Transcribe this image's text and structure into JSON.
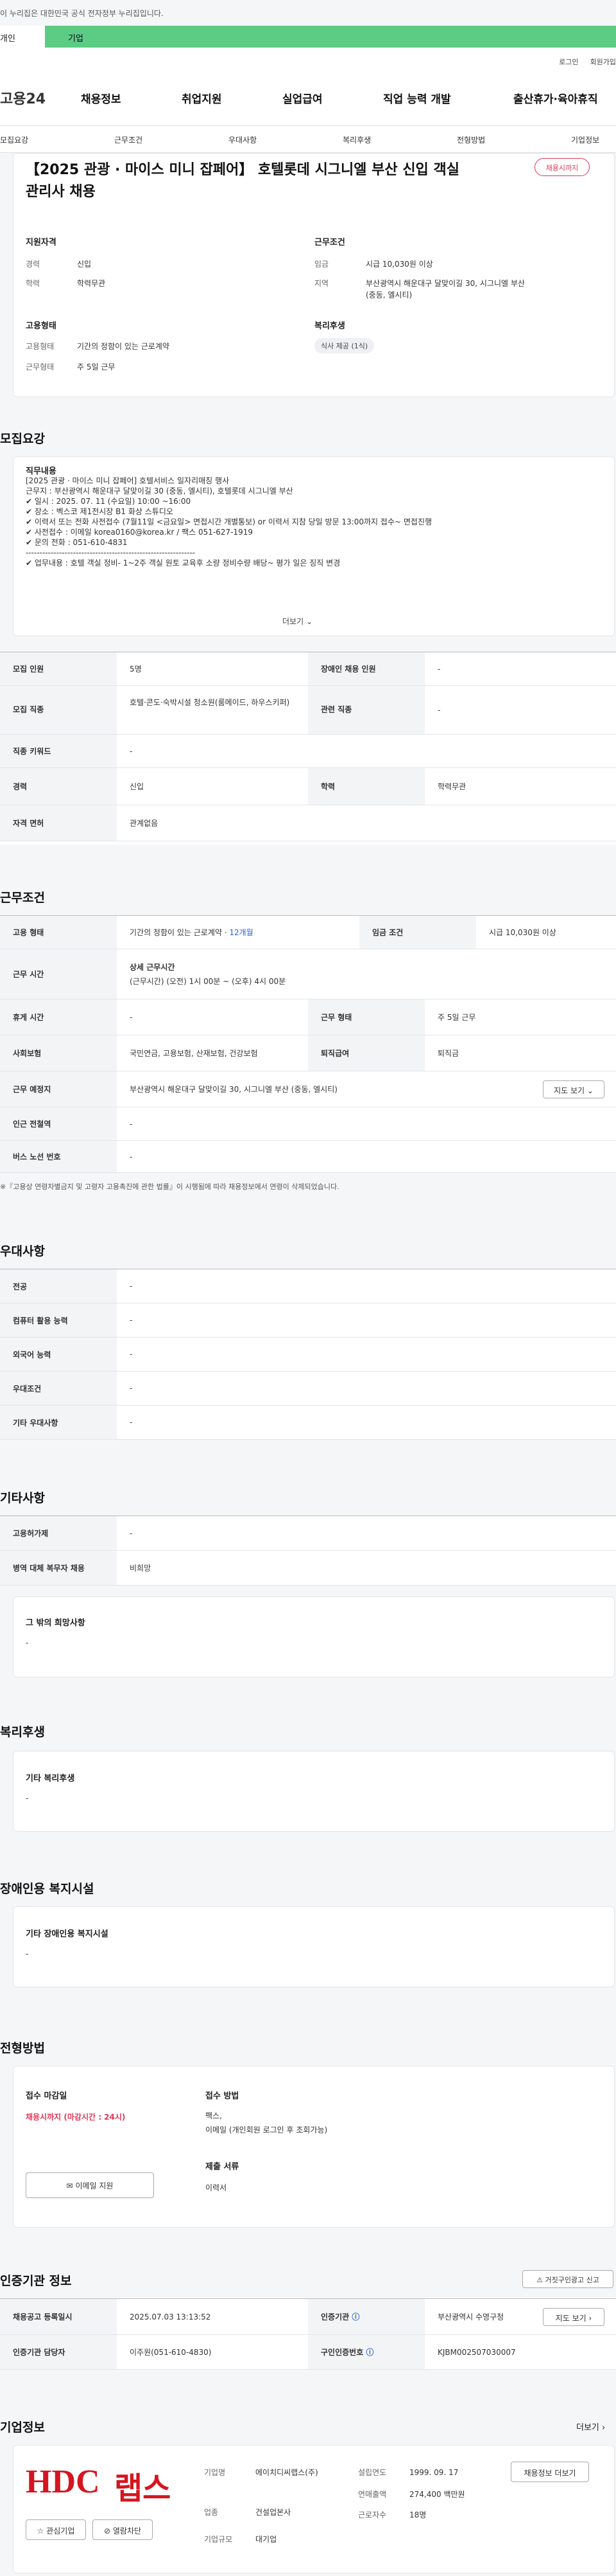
{
  "gov_banner": "이 누리집은 대한민국 공식 전자정부 누리집입니다.",
  "top_tabs": [
    "개인",
    "기업"
  ],
  "utils": [
    "로그인",
    "회원가입"
  ],
  "logo": "고용24",
  "gnb": [
    "채용정보",
    "취업지원",
    "실업급여",
    "직업 능력 개발",
    "출산휴가·육아휴직"
  ],
  "subnav": [
    "모집요강",
    "근무조건",
    "우대사항",
    "복리후생",
    "전형방법",
    "기업정보"
  ],
  "job": {
    "title": "【2025 관광 · 마이스 미니 잡페어】 호텔롯데 시그니엘 부산 신입 객실관리사 채용",
    "badge": "채용시까지",
    "qual_h": "지원자격",
    "career_k": "경력",
    "career_v": "신입",
    "edu_k": "학력",
    "edu_v": "학력무관",
    "cond_h": "근무조건",
    "wage_k": "임금",
    "wage_v": "시급 10,030원 이상",
    "area_k": "지역",
    "area_v": "부산광역시 해운대구 달맞이길 30, 시그니엘 부산 (중동, 엘시티)",
    "emp_h": "고용형태",
    "emptype_k": "고용형태",
    "emptype_v": "기간의 정함이 있는 근로계약",
    "worktype_k": "근무형태",
    "worktype_v": "주 5일 근무",
    "welfare_h": "복리후생",
    "welfare_pill": "식사 제공 (1식)"
  },
  "recruit": {
    "h": "모집요강",
    "duty_h": "직무내용",
    "desc": "[2025 관광 · 마이스 미니 잡페어] 호텔서비스 일자리매칭 행사\n근무지 : 부산광역시 해운대구 달맞이길 30 (중동, 엘시티), 호텔롯데 시그니엘 부산\n✔ 일시 : 2025. 07. 11 (수요일) 10:00 ~16:00\n✔ 장소 : 벡스코 제1전시장 B1 화상 스튜디오\n✔ 이력서 또는 전화 사전접수 (7월11일 <금요일> 면접시간 개별통보) or 이력서 지참 당일 방문 13:00까지 접수~ 면접진행\n✔ 사전접수 : 이메일 korea0160@korea.kr / 팩스 051-627-1919\n✔ 문의 전화 : 051-610-4831\n-------------------------------------------------------------\n✔ 업무내용 : 호텔 객실 정비- 1~2주 객실 원토 교육후 소량 정비수량 배당~ 평가 일은 징직 변경",
    "more": "더보기",
    "rows": [
      {
        "k": "모집 인원",
        "v": "5명",
        "k2": "장애인 채용 인원",
        "v2": "-"
      },
      {
        "k": "모집 직종",
        "v": "호텔·콘도·숙박시설 청소원(룸메이드, 하우스키퍼)",
        "k2": "관련 직종",
        "v2": "-"
      },
      {
        "k": "직종 키워드",
        "v": "-"
      },
      {
        "k": "경력",
        "v": "신입",
        "k2": "학력",
        "v2": "학력무관"
      },
      {
        "k": "자격 면허",
        "v": "관계없음"
      }
    ]
  },
  "conditions": {
    "h": "근무조건",
    "emp_k": "고용 형태",
    "emp_v": "기간의 정함이 있는 근로계약 · ",
    "emp_v2": "12개월",
    "wage_k": "임금 조건",
    "wage_v": "시급 10,030원 이상",
    "hours_k": "근무 시간",
    "hours_h": "상세 근무시간",
    "hours_v": "(근무시간) (오전) 1시 00분 ~ (오후) 4시 00분",
    "rest_k": "휴게 시간",
    "rest_v": "-",
    "type_k": "근무 형태",
    "type_v": "주 5일 근무",
    "ins_k": "사회보험",
    "ins_v": "국민연금, 고용보험, 산재보험, 건강보험",
    "ret_k": "퇴직급여",
    "ret_v": "퇴직금",
    "place_k": "근무 예정지",
    "place_v": "부산광역시 해운대구 달맞이길 30, 시그니엘 부산 (중동, 엘시티)",
    "map_btn": "지도 보기",
    "sub_k": "인근 전철역",
    "sub_v": "-",
    "bus_k": "버스 노선 번호",
    "bus_v": "-",
    "note": "※『고용상 연령차별금지 및 고령자 고용촉진에 관한 법률』이 시행됨에 따라 채용정보에서 연령이 삭제되었습니다."
  },
  "pref": {
    "h": "우대사항",
    "rows": [
      {
        "k": "전공",
        "v": "-"
      },
      {
        "k": "컴퓨터 활용 능력",
        "v": "-"
      },
      {
        "k": "외국어 능력",
        "v": "-"
      },
      {
        "k": "우대조건",
        "v": "-"
      },
      {
        "k": "기타 우대사항",
        "v": "-"
      }
    ]
  },
  "etc": {
    "h": "기타사항",
    "rows": [
      {
        "k": "고용허가제",
        "v": "-"
      },
      {
        "k": "병역 대체 복무자 채용",
        "v": "비희망"
      }
    ],
    "hope_h": "그 밖의 희망사항",
    "hope_v": "-"
  },
  "welfare": {
    "h": "복리후생",
    "sub_h": "기타 복리후생",
    "v": "-"
  },
  "disabled": {
    "h": "장애인용 복지시설",
    "sub_h": "기타 장애인용 복지시설",
    "v": "-"
  },
  "process": {
    "h": "전형방법",
    "deadline_h": "접수 마감일",
    "deadline_v": "채용시까지 (마감시간 : 24시)",
    "method_h": "접수 방법",
    "method_v1": "팩스,",
    "method_v2": "이메일 (개인회원 로그인 후 조회가능)",
    "docs_h": "제출 서류",
    "docs_v": "이력서",
    "apply_btn": "이메일 지원"
  },
  "cert": {
    "h": "인증기관 정보",
    "report_btn": "거짓구인광고 신고",
    "reg_k": "채용공고 등록일시",
    "reg_v": "2025.07.03 13:13:52",
    "org_k": "인증기관",
    "org_v": "부산광역시 수영구청",
    "map_btn": "지도 보기",
    "mgr_k": "인증기관 담당자",
    "mgr_v": "이주원(051-610-4830)",
    "no_k": "구인인증번호",
    "no_v": "KJBM002507030007"
  },
  "company": {
    "h": "기업정보",
    "more": "더보기",
    "logo_en": "HDC",
    "logo_ko": "랩스",
    "fav_btn": "관심기업",
    "block_btn": "열람차단",
    "name_k": "기업명",
    "name_v": "에이치디씨랩스(주)",
    "ind_k": "업종",
    "ind_v": "건설업본사",
    "size_k": "기업규모",
    "size_v": "대기업",
    "est_k": "설립연도",
    "est_v": "1999. 09. 17",
    "sales_k": "연매출액",
    "sales_v": "274,400 백만원",
    "emp_k": "근로자수",
    "emp_v": "18명",
    "info_btn": "채용정보 더보기"
  }
}
